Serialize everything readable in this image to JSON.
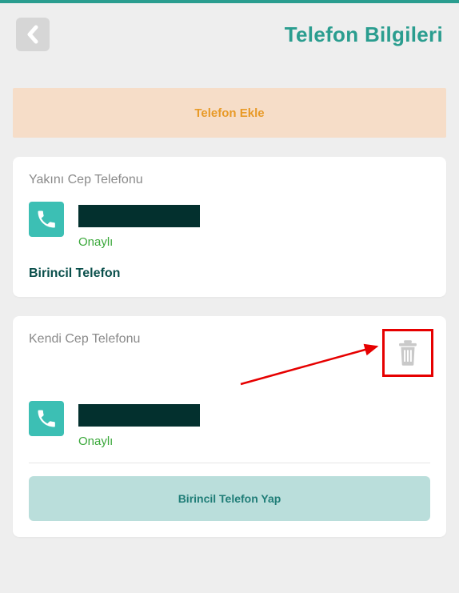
{
  "header": {
    "title": "Telefon Bilgileri"
  },
  "add_button_label": "Telefon Ekle",
  "cards": [
    {
      "title": "Yakını Cep Telefonu",
      "status": "Onaylı",
      "primary_label": "Birincil Telefon"
    },
    {
      "title": "Kendi Cep Telefonu",
      "status": "Onaylı",
      "make_primary_label": "Birincil Telefon Yap"
    }
  ]
}
